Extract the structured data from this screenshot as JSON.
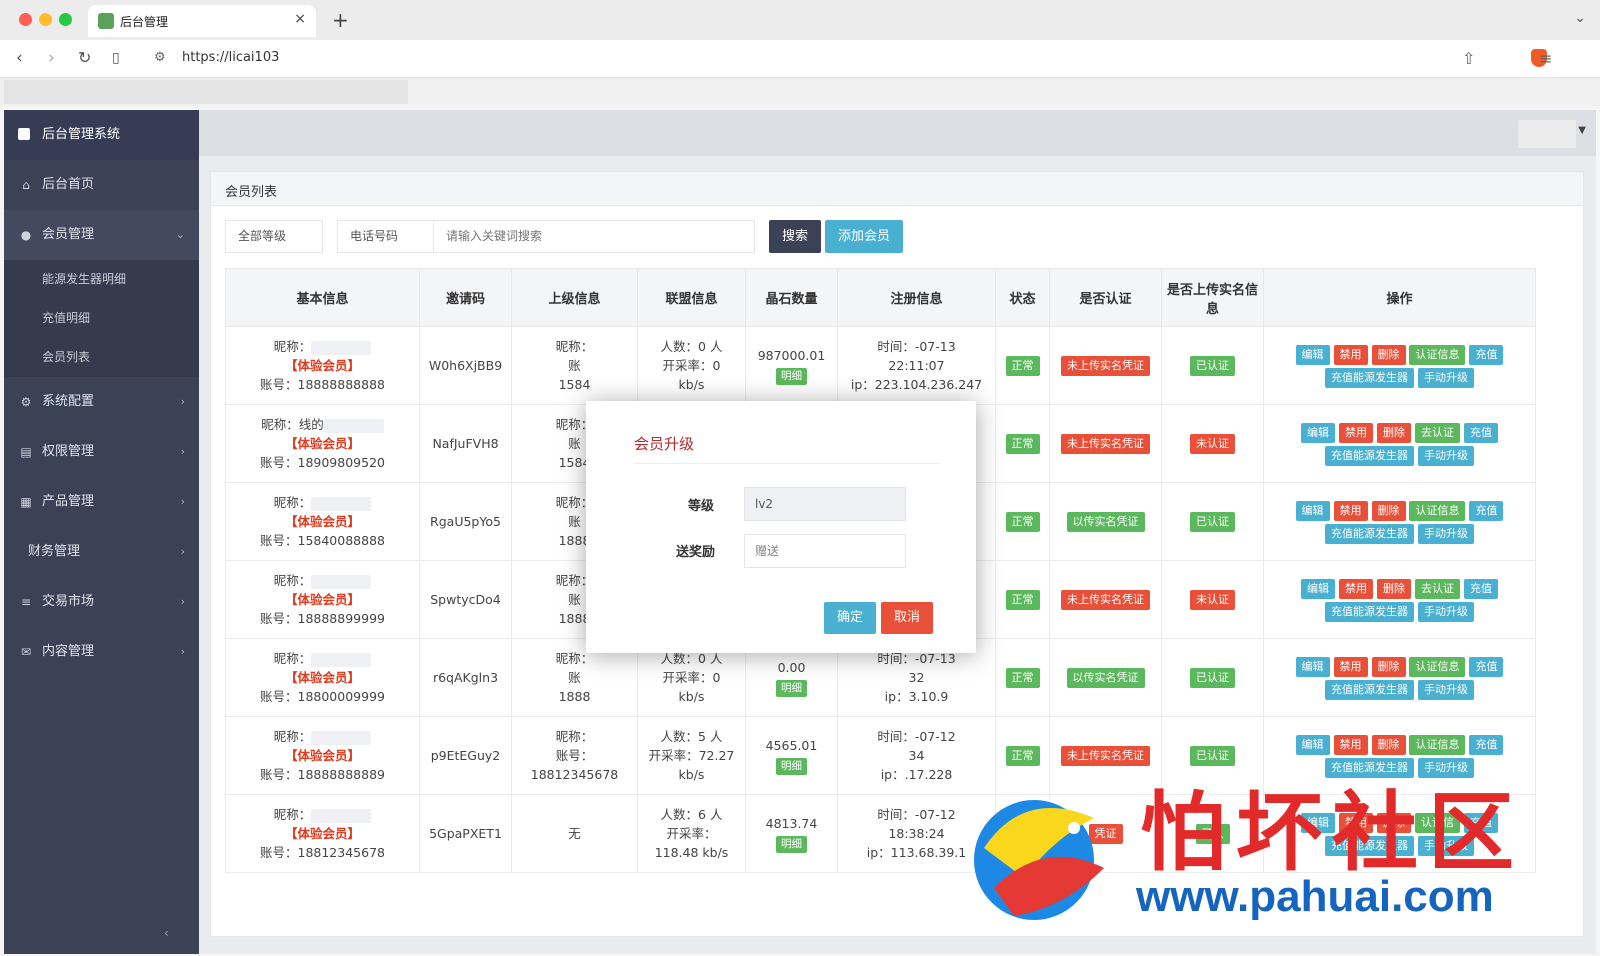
{
  "browser": {
    "tab_title": "后台管理",
    "tab_close": "×",
    "new_tab": "+",
    "url": "https://licai103"
  },
  "sidebar": {
    "brand": "后台管理系统",
    "items": [
      {
        "label": "后台首页",
        "icon": "home-icon"
      },
      {
        "label": "会员管理",
        "icon": "user-icon",
        "expanded": true,
        "children": [
          "能源发生器明细",
          "充值明细",
          "会员列表"
        ]
      },
      {
        "label": "系统配置",
        "icon": "gears-icon"
      },
      {
        "label": "权限管理",
        "icon": "list-icon"
      },
      {
        "label": "产品管理",
        "icon": "grid-icon"
      },
      {
        "label": "财务管理",
        "icon": ""
      },
      {
        "label": "交易市场",
        "icon": "bars-icon"
      },
      {
        "label": "内容管理",
        "icon": "mail-icon"
      }
    ],
    "collapse": "‹"
  },
  "panel": {
    "title": "会员列表",
    "filter_level": "全部等级",
    "filter_field": "电话号码",
    "search_placeholder": "请输入关键词搜索",
    "search_button": "搜索",
    "add_button": "添加会员"
  },
  "table": {
    "headers": [
      "基本信息",
      "邀请码",
      "上级信息",
      "联盟信息",
      "晶石数量",
      "注册信息",
      "状态",
      "是否认证",
      "是否上传实名信息",
      "操作"
    ],
    "detail_label": "明细",
    "rows": [
      {
        "nick": "昵称：",
        "vip": "【体验会员】",
        "account": "账号：18888888888",
        "code": "W0h6XjBB9",
        "parent": [
          "昵称：",
          "账",
          "1584"
        ],
        "alliance": [
          "人数：0 人",
          "开采率：0",
          "kb/s"
        ],
        "crystal": "987000.01",
        "reg": [
          "时间：-07-13",
          "22:11:07",
          "ip：223.104.236.247"
        ],
        "status": "正常",
        "cert": "未上传实名凭证",
        "cert_color": "red",
        "uploaded": "已认证",
        "uploaded_color": "green",
        "cert_op": "认证信息"
      },
      {
        "nick": "昵称：线的",
        "vip": "【体验会员】",
        "account": "账号：18909809520",
        "code": "NafJuFVH8",
        "parent": [
          "昵称：",
          "账",
          "1584"
        ],
        "alliance": [
          "",
          "",
          ""
        ],
        "crystal": "",
        "reg": [
          "13",
          "",
          "228"
        ],
        "status": "正常",
        "cert": "未上传实名凭证",
        "cert_color": "red",
        "uploaded": "未认证",
        "uploaded_color": "red",
        "cert_op": "去认证"
      },
      {
        "nick": "昵称：",
        "vip": "【体验会员】",
        "account": "账号：15840088888",
        "code": "RgaU5pYo5",
        "parent": [
          "昵称：",
          "账",
          "1888"
        ],
        "alliance": [
          "",
          "",
          ""
        ],
        "crystal": "",
        "reg": [
          "13",
          "",
          "228"
        ],
        "status": "正常",
        "cert": "以传实名凭证",
        "cert_color": "green",
        "uploaded": "已认证",
        "uploaded_color": "green",
        "cert_op": "认证信息"
      },
      {
        "nick": "昵称：",
        "vip": "【体验会员】",
        "account": "账号：18888899999",
        "code": "SpwtycDo4",
        "parent": [
          "昵称：",
          "账",
          "1888"
        ],
        "alliance": [
          "",
          "",
          ""
        ],
        "crystal": "",
        "reg": [
          "13",
          "",
          "9"
        ],
        "status": "正常",
        "cert": "未上传实名凭证",
        "cert_color": "red",
        "uploaded": "未认证",
        "uploaded_color": "red",
        "cert_op": "去认证"
      },
      {
        "nick": "昵称：",
        "vip": "【体验会员】",
        "account": "账号：18800009999",
        "code": "r6qAKgln3",
        "parent": [
          "昵称：",
          "账",
          "1888"
        ],
        "alliance": [
          "人数：0 人",
          "开采率：0",
          "kb/s"
        ],
        "crystal": "0.00",
        "reg": [
          "时间：-07-13",
          "32",
          "ip：3.10.9"
        ],
        "status": "正常",
        "cert": "以传实名凭证",
        "cert_color": "green",
        "uploaded": "已认证",
        "uploaded_color": "green",
        "cert_op": "认证信息"
      },
      {
        "nick": "昵称：",
        "vip": "【体验会员】",
        "account": "账号：18888888889",
        "code": "p9EtEGuy2",
        "parent": [
          "昵称：",
          "账号：",
          "18812345678"
        ],
        "alliance": [
          "人数：5 人",
          "开采率：72.27",
          "kb/s"
        ],
        "crystal": "4565.01",
        "reg": [
          "时间：-07-12",
          "34",
          "ip：.17.228"
        ],
        "status": "正常",
        "cert": "未上传实名凭证",
        "cert_color": "red",
        "uploaded": "已认证",
        "uploaded_color": "green",
        "cert_op": "认证信息"
      },
      {
        "nick": "昵称：",
        "vip": "【体验会员】",
        "account": "账号：18812345678",
        "code": "5GpaPXET1",
        "parent": [
          "无",
          "",
          ""
        ],
        "alliance": [
          "人数：6 人",
          "开采率：",
          "118.48 kb/s"
        ],
        "crystal": "4813.74",
        "reg": [
          "时间：-07-12",
          "18:38:24",
          "ip：113.68.39.1"
        ],
        "status": "正常",
        "cert": "凭证",
        "cert_color": "red",
        "uploaded": "已认",
        "uploaded_color": "green",
        "cert_op": "认证信"
      }
    ],
    "ops": {
      "edit": "编辑",
      "ban": "禁用",
      "delete": "删除",
      "recharge": "充值",
      "generator": "充值能源发生器",
      "upgrade": "手动升级"
    }
  },
  "modal": {
    "title": "会员升级",
    "level_label": "等级",
    "level_value": "lv2",
    "reward_label": "送奖励",
    "reward_placeholder": "赠送",
    "ok": "确定",
    "cancel": "取消"
  },
  "watermark": {
    "text": "怕坏社区",
    "url": "www.pahuai.com"
  },
  "colors": {
    "sidebar": "#3c4255",
    "green": "#5cb85c",
    "red": "#e8503a",
    "blue": "#4ab0d2",
    "dark_button": "#3c4255"
  }
}
